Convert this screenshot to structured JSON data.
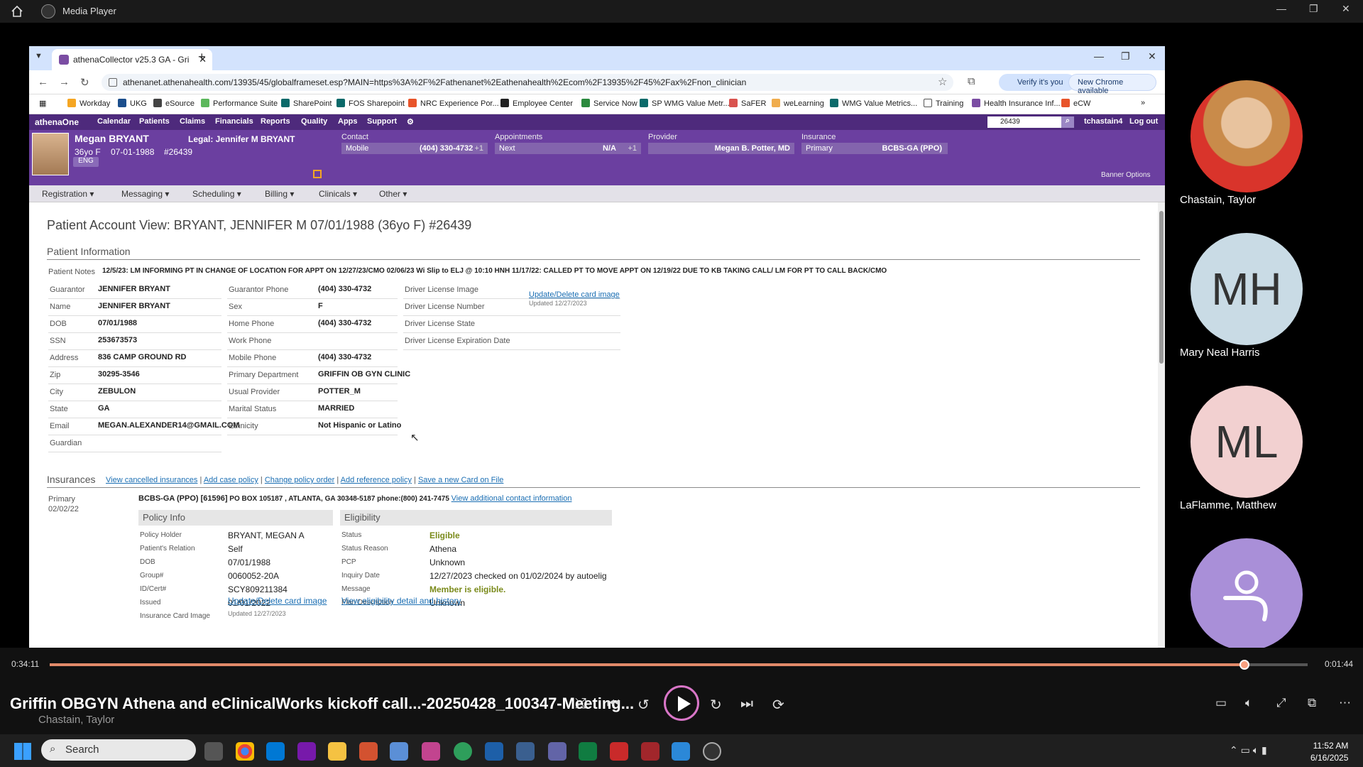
{
  "media_player": {
    "title": "Media Player",
    "current_time": "0:34:11",
    "remaining_time": "0:01:44",
    "progress": 0.95,
    "meeting_title": "Griffin OBGYN Athena and eClinicalWorks kickoff call...-20250428_100347-Meeting...",
    "presenter": "Chastain, Taylor"
  },
  "participants": [
    {
      "name": "Chastain, Taylor",
      "initials": ""
    },
    {
      "name": "Mary Neal Harris",
      "initials": "MH"
    },
    {
      "name": "LaFlamme, Matthew",
      "initials": "ML"
    },
    {
      "name": "",
      "initials": ""
    }
  ],
  "browser": {
    "tab_title": "athenaCollector v25.3 GA - Gri",
    "url": "athenanet.athenahealth.com/13935/45/globalframeset.esp?MAIN=https%3A%2F%2Fathenanet%2Eathenahealth%2Ecom%2F13935%2F45%2Fax%2Fnon_clinician",
    "verify": "Verify it's you",
    "new_chrome": "New Chrome available",
    "bookmarks": [
      "Workday",
      "UKG",
      "eSource",
      "Performance Suite",
      "SharePoint",
      "FOS Sharepoint",
      "NRC Experience Por...",
      "Employee Center",
      "Service Now",
      "SP WMG Value Metr...",
      "SaFER",
      "weLearning",
      "WMG Value Metrics...",
      "Training",
      "Health Insurance Inf...",
      "eCW"
    ]
  },
  "athena": {
    "brand": "athenaOne",
    "nav": [
      "Calendar",
      "Patients",
      "Claims",
      "Financials",
      "Reports",
      "Quality",
      "Apps",
      "Support"
    ],
    "search_value": "26439",
    "user": "tchastain4",
    "logout": "Log out",
    "patient": {
      "name": "Megan BRYANT",
      "legal": "Legal: Jennifer M BRYANT",
      "age": "36yo F",
      "dob": "07-01-1988",
      "id": "#26439",
      "lang": "ENG"
    },
    "contact": {
      "label": "Contact",
      "type": "Mobile",
      "value": "(404) 330-4732",
      "more": "+1"
    },
    "appointments": {
      "label": "Appointments",
      "type": "Next",
      "value": "N/A",
      "more": "+1"
    },
    "provider": {
      "label": "Provider",
      "value": "Megan B. Potter, MD"
    },
    "insurance": {
      "label": "Insurance",
      "type": "Primary",
      "value": "BCBS-GA (PPO)"
    },
    "banner_options": "Banner Options",
    "menu": [
      "Registration ▾",
      "Messaging ▾",
      "Scheduling ▾",
      "Billing ▾",
      "Clinicals ▾",
      "Other ▾"
    ]
  },
  "page": {
    "title": "Patient Account View: BRYANT, JENNIFER M 07/01/1988 (36yo F) #26439",
    "patient_info": "Patient Information",
    "notes_label": "Patient Notes",
    "notes": "12/5/23: LM INFORMING PT IN CHANGE OF LOCATION FOR APPT ON 12/27/23/CMO 02/06/23 Wi Slip to ELJ @ 10:10 HNH 11/17/22: CALLED PT TO MOVE APPT ON 12/19/22 DUE TO KB TAKING CALL/ LM FOR PT TO CALL BACK/CMO",
    "col1": [
      [
        "Guarantor",
        "JENNIFER BRYANT"
      ],
      [
        "Name",
        "JENNIFER BRYANT"
      ],
      [
        "DOB",
        "07/01/1988"
      ],
      [
        "SSN",
        "253673573"
      ],
      [
        "Address",
        "836 CAMP GROUND RD"
      ],
      [
        "Zip",
        "30295-3546"
      ],
      [
        "City",
        "ZEBULON"
      ],
      [
        "State",
        "GA"
      ],
      [
        "Email",
        "MEGAN.ALEXANDER14@GMAIL.COM"
      ],
      [
        "Guardian",
        ""
      ]
    ],
    "col2": [
      [
        "Guarantor Phone",
        "(404) 330-4732"
      ],
      [
        "Sex",
        "F"
      ],
      [
        "Home Phone",
        "(404) 330-4732"
      ],
      [
        "Work Phone",
        ""
      ],
      [
        "Mobile Phone",
        "(404) 330-4732"
      ],
      [
        "Primary Department",
        "GRIFFIN OB GYN CLINIC"
      ],
      [
        "Usual Provider",
        "POTTER_M"
      ],
      [
        "Marital Status",
        "MARRIED"
      ],
      [
        "Ethnicity",
        "Not Hispanic or Latino"
      ]
    ],
    "col3": [
      [
        "Driver License Image",
        ""
      ],
      [
        "Driver License Number",
        ""
      ],
      [
        "Driver License State",
        ""
      ],
      [
        "Driver License Expiration Date",
        ""
      ]
    ],
    "dl_link": "Update/Delete card image",
    "dl_updated": "Updated 12/27/2023",
    "insurances": "Insurances",
    "ins_links": [
      "View cancelled insurances",
      "Add case policy",
      "Change policy order",
      "Add reference policy",
      "Save a new Card on File"
    ],
    "primary_label": "Primary",
    "primary_date": "02/02/22",
    "ins_name": "BCBS-GA (PPO) [61596]",
    "ins_addr": "PO BOX 105187 , ATLANTA, GA 30348-5187",
    "ins_phone": "phone:(800) 241-7475",
    "ins_contact_link": "View additional contact information",
    "policy_info": "Policy Info",
    "eligibility": "Eligibility",
    "policy": [
      [
        "Policy Holder",
        "BRYANT, MEGAN A"
      ],
      [
        "Patient's Relation",
        "Self"
      ],
      [
        "DOB",
        "07/01/1988"
      ],
      [
        "Group#",
        "0060052-20A"
      ],
      [
        "ID/Cert#",
        "SCY809211384"
      ],
      [
        "Issued",
        "01/01/2022"
      ],
      [
        "Insurance Card Image",
        ""
      ]
    ],
    "elig": [
      [
        "Status",
        "Eligible"
      ],
      [
        "Status Reason",
        "Athena"
      ],
      [
        "PCP",
        "Unknown"
      ],
      [
        "Inquiry Date",
        "12/27/2023 checked on 01/02/2024 by autoelig"
      ],
      [
        "Message",
        "Member is eligible."
      ],
      [
        "Plan Description",
        "Unknown"
      ]
    ],
    "card_link": "Update/Delete card image",
    "card_updated": "Updated 12/27/2023",
    "elig_link": "View eligibility detail and history"
  },
  "taskbar": {
    "search": "Search",
    "time": "11:52 AM",
    "date": "6/16/2025"
  }
}
